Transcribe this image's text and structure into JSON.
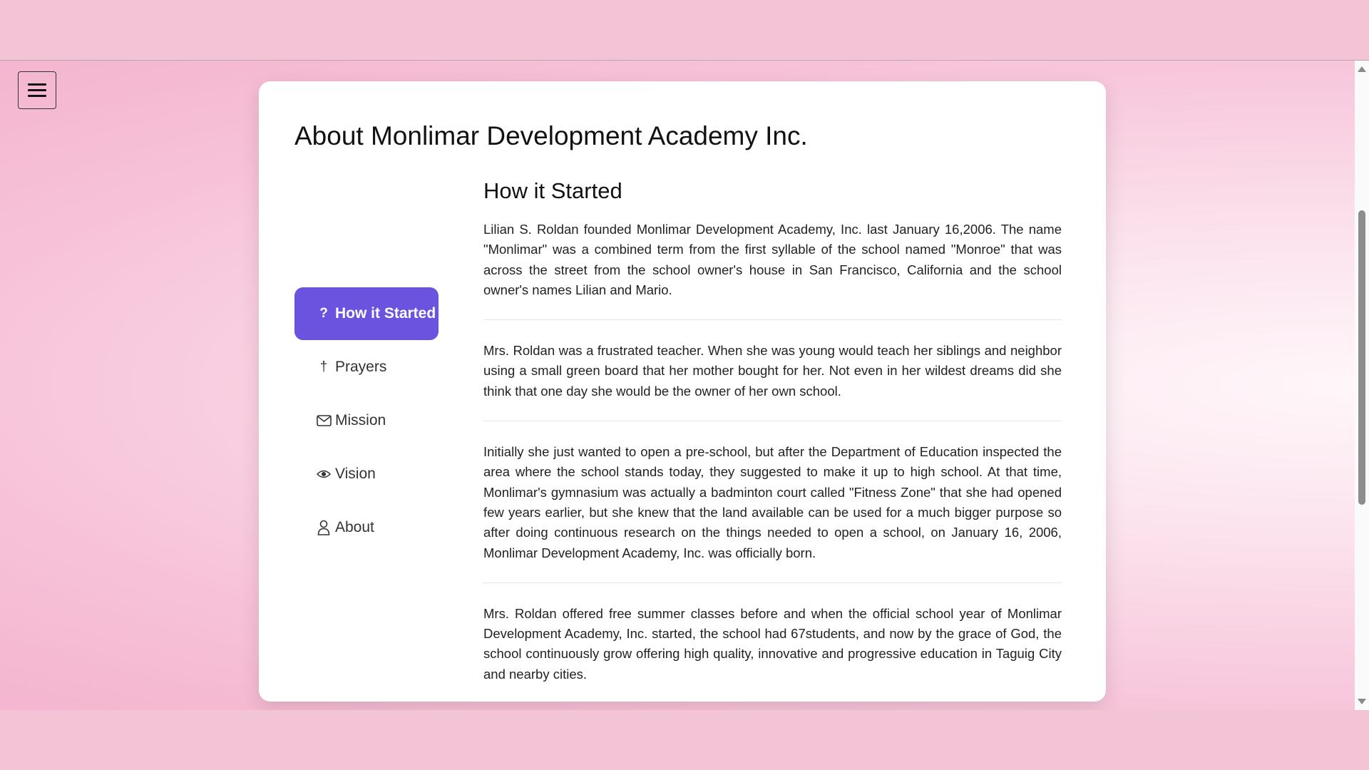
{
  "page": {
    "title": "About Monlimar Development Academy Inc."
  },
  "menu": {
    "icon": "hamburger-menu-icon"
  },
  "nav": {
    "items": [
      {
        "icon_glyph": "?",
        "icon": "question-icon",
        "label": "How it Started",
        "active": true
      },
      {
        "icon_glyph": "†",
        "icon": "cross-icon",
        "label": "Prayers",
        "active": false
      },
      {
        "icon_glyph": "",
        "icon": "envelope-icon",
        "label": "Mission",
        "active": false
      },
      {
        "icon_glyph": "",
        "icon": "eye-icon",
        "label": "Vision",
        "active": false
      },
      {
        "icon_glyph": "",
        "icon": "person-icon",
        "label": "About",
        "active": false
      }
    ]
  },
  "section": {
    "heading": "How it Started",
    "paragraphs": [
      "Lilian S. Roldan founded Monlimar Development Academy, Inc. last January 16,2006. The name \"Monlimar\" was a combined term from the first syllable of the school named \"Monroe\" that was across the street from the school owner's house in San Francisco, California and the school owner's names Lilian and Mario.",
      "Mrs. Roldan was a frustrated teacher. When she was young would teach her siblings and neighbor using a small green board that her mother bought for her. Not even in her wildest dreams did she think that one day she would be the owner of her own school.",
      "Initially she just wanted to open a pre-school, but after the Department of Education inspected the area where the school stands today, they suggested to make it up to high school. At that time, Monlimar's gymnasium was actually a badminton court called \"Fitness Zone\" that she had opened few years earlier, but she knew that the land available can be used for a much bigger purpose so after doing continuous research on the things needed to open a school, on January 16, 2006, Monlimar Development Academy, Inc. was officially born.",
      "Mrs. Roldan offered free summer classes before and when the official school year of Monlimar Development Academy, Inc. started, the school had 67students, and now by the grace of God, the school continuously grow offering high quality, innovative and progressive education in Taguig City and nearby cities."
    ]
  },
  "colors": {
    "accent": "#6b53e0",
    "page_background": "#f3c3d6",
    "card_background": "#ffffff"
  }
}
